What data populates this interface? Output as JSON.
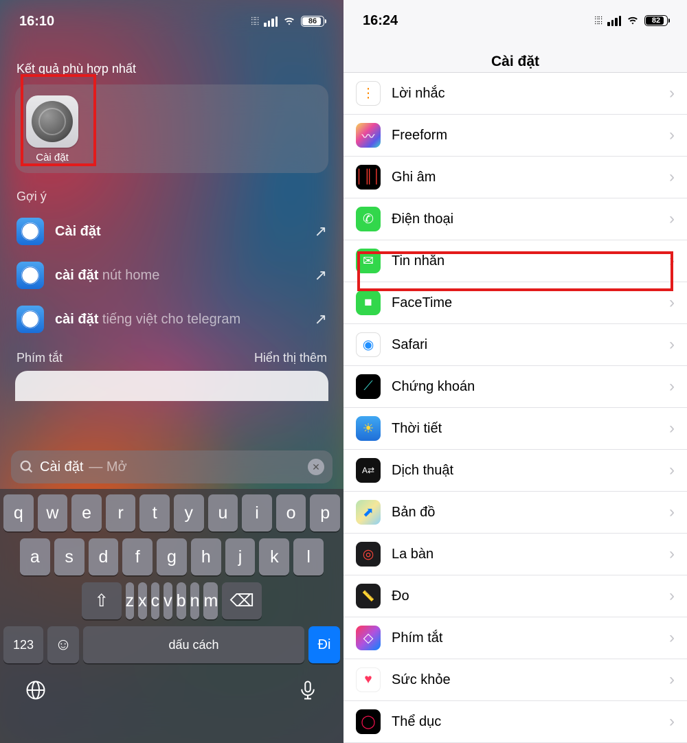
{
  "left": {
    "time": "16:10",
    "battery": "86",
    "best_match_heading": "Kết quả phù hợp nhất",
    "top_app_label": "Cài đặt",
    "suggestions_heading": "Gợi ý",
    "suggestions": [
      {
        "bold": "Cài đặt",
        "dim": ""
      },
      {
        "bold": "cài đặt ",
        "dim": "nút home"
      },
      {
        "bold": "cài đặt ",
        "dim": "tiếng việt cho telegram"
      }
    ],
    "shortcuts_label": "Phím tắt",
    "show_more_label": "Hiển thị thêm",
    "search_value": "Cài đặt",
    "search_hint": " — Mở",
    "keyboard": {
      "row1": [
        "q",
        "w",
        "e",
        "r",
        "t",
        "y",
        "u",
        "i",
        "o",
        "p"
      ],
      "row2": [
        "a",
        "s",
        "d",
        "f",
        "g",
        "h",
        "j",
        "k",
        "l"
      ],
      "row3": [
        "z",
        "x",
        "c",
        "v",
        "b",
        "n",
        "m"
      ],
      "num": "123",
      "space": "dấu cách",
      "go": "Đi"
    }
  },
  "right": {
    "time": "16:24",
    "battery": "82",
    "title": "Cài đặt",
    "items": [
      {
        "label": "Lời nhắc",
        "bg": "#ffffff",
        "border": "1px solid #ddd",
        "glyph": "⋮",
        "fg": "#ff8a00"
      },
      {
        "label": "Freeform",
        "bg": "linear-gradient(135deg,#f7d358,#e84a9c 40%,#5a5ae8 75%,#3ad1c9)",
        "glyph": "〰",
        "fg": "#fff"
      },
      {
        "label": "Ghi âm",
        "bg": "#000000",
        "glyph": "│║│",
        "fg": "#ff3b30"
      },
      {
        "label": "Điện thoại",
        "bg": "#32d74b",
        "glyph": "✆",
        "fg": "#fff"
      },
      {
        "label": "Tin nhắn",
        "bg": "#32d74b",
        "glyph": "✉",
        "fg": "#fff"
      },
      {
        "label": "FaceTime",
        "bg": "#32d74b",
        "glyph": "■",
        "fg": "#fff"
      },
      {
        "label": "Safari",
        "bg": "#ffffff",
        "border": "1px solid #ddd",
        "glyph": "◉",
        "fg": "#1f8fff"
      },
      {
        "label": "Chứng khoán",
        "bg": "#000000",
        "glyph": "⟋",
        "fg": "#3ad1c9"
      },
      {
        "label": "Thời tiết",
        "bg": "linear-gradient(#3fa7f2,#1f6fd8)",
        "glyph": "☀",
        "fg": "#ffd93b"
      },
      {
        "label": "Dịch thuật",
        "bg": "#111111",
        "glyph": "A⇄",
        "fg": "#fff",
        "fs": "12px"
      },
      {
        "label": "Bản đồ",
        "bg": "linear-gradient(135deg,#b6e3b1,#f5e79a 50%,#8ed1f5)",
        "glyph": "⬈",
        "fg": "#0a7aff"
      },
      {
        "label": "La bàn",
        "bg": "#1c1c1e",
        "glyph": "◎",
        "fg": "#ff453a"
      },
      {
        "label": "Đo",
        "bg": "#1c1c1e",
        "glyph": "📏",
        "fg": "#ffd60a",
        "fs": "15px"
      },
      {
        "label": "Phím tắt",
        "bg": "linear-gradient(135deg,#ff375f,#af52de 50%,#0a84ff)",
        "glyph": "◇",
        "fg": "#fff"
      },
      {
        "label": "Sức khỏe",
        "bg": "#ffffff",
        "border": "1px solid #eee",
        "glyph": "♥",
        "fg": "#ff375f"
      },
      {
        "label": "Thể dục",
        "bg": "#000000",
        "glyph": "◯",
        "fg": "#fa114f"
      }
    ]
  }
}
